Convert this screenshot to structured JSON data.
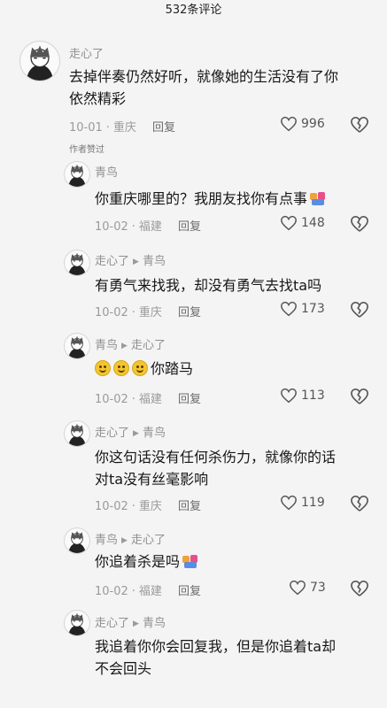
{
  "header": {
    "title": "532条评论"
  },
  "comments": [
    {
      "name": "走心了",
      "reply_to": "",
      "lines": [
        "去掉伴奏仍然好听，就像她的生活没有了你",
        "依然精彩"
      ],
      "date": "10-01",
      "location": "重庆",
      "reply": "回复",
      "likes": "996",
      "author_tag": "作者赞过",
      "emoji_count": 0,
      "has_sticker": false
    },
    {
      "name": "青鸟",
      "reply_to": "",
      "lines": [
        "你重庆哪里的？我朋友找你有点事"
      ],
      "date": "10-02",
      "location": "福建",
      "reply": "回复",
      "likes": "148",
      "author_tag": "",
      "emoji_count": 0,
      "has_sticker": true
    },
    {
      "name": "走心了",
      "reply_to": "青鸟",
      "lines": [
        "有勇气来找我，却没有勇气去找ta吗"
      ],
      "date": "10-02",
      "location": "重庆",
      "reply": "回复",
      "likes": "173",
      "author_tag": "",
      "emoji_count": 0,
      "has_sticker": false
    },
    {
      "name": "青鸟",
      "reply_to": "走心了",
      "lines": [
        "你踏马"
      ],
      "date": "10-02",
      "location": "福建",
      "reply": "回复",
      "likes": "113",
      "author_tag": "",
      "emoji_count": 3,
      "has_sticker": false
    },
    {
      "name": "走心了",
      "reply_to": "青鸟",
      "lines": [
        "你这句话没有任何杀伤力，就像你的话",
        "对ta没有丝毫影响"
      ],
      "date": "10-02",
      "location": "重庆",
      "reply": "回复",
      "likes": "119",
      "author_tag": "",
      "emoji_count": 0,
      "has_sticker": false
    },
    {
      "name": "青鸟",
      "reply_to": "走心了",
      "lines": [
        "你追着杀是吗"
      ],
      "date": "10-02",
      "location": "福建",
      "reply": "回复",
      "likes": "73",
      "author_tag": "",
      "emoji_count": 0,
      "has_sticker": true
    },
    {
      "name": "走心了",
      "reply_to": "青鸟",
      "lines": [
        "我追着你你会回复我，但是你追着ta却",
        "不会回头"
      ],
      "date": "",
      "location": "",
      "reply": "",
      "likes": "",
      "author_tag": "",
      "emoji_count": 0,
      "has_sticker": false
    }
  ]
}
